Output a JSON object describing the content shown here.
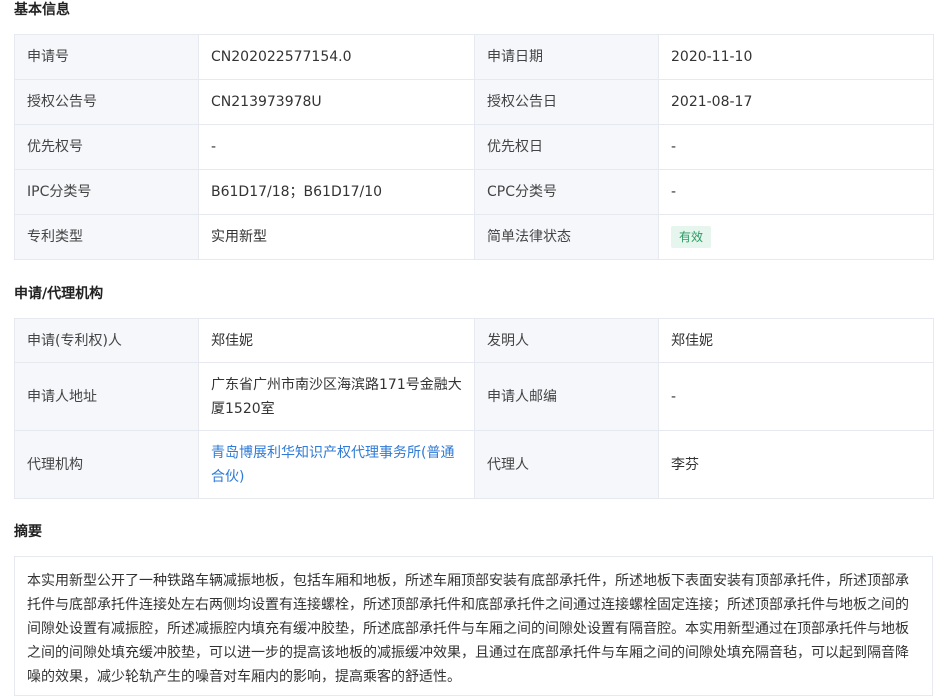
{
  "basic": {
    "title": "基本信息",
    "rows": [
      [
        "申请号",
        "CN202022577154.0",
        "申请日期",
        "2020-11-10"
      ],
      [
        "授权公告号",
        "CN213973978U",
        "授权公告日",
        "2021-08-17"
      ],
      [
        "优先权号",
        "-",
        "优先权日",
        "-"
      ],
      [
        "IPC分类号",
        "B61D17/18；B61D17/10",
        "CPC分类号",
        "-"
      ],
      [
        "专利类型",
        "实用新型",
        "简单法律状态",
        "有效"
      ]
    ]
  },
  "agency": {
    "title": "申请/代理机构",
    "rows": [
      [
        "申请(专利权)人",
        "郑佳妮",
        "发明人",
        "郑佳妮"
      ],
      [
        "申请人地址",
        "广东省广州市南沙区海滨路171号金融大厦1520室",
        "申请人邮编",
        "-"
      ],
      [
        "代理机构",
        "青岛博展利华知识产权代理事务所(普通合伙)",
        "代理人",
        "李芬"
      ]
    ]
  },
  "abstract": {
    "title": "摘要",
    "text": "本实用新型公开了一种铁路车辆减振地板，包括车厢和地板，所述车厢顶部安装有底部承托件，所述地板下表面安装有顶部承托件，所述顶部承托件与底部承托件连接处左右两侧均设置有连接螺栓，所述顶部承托件和底部承托件之间通过连接螺栓固定连接；所述顶部承托件与地板之间的间隙处设置有减振腔，所述减振腔内填充有缓冲胶垫，所述底部承托件与车厢之间的间隙处设置有隔音腔。本实用新型通过在顶部承托件与地板之间的间隙处填充缓冲胶垫，可以进一步的提高该地板的减振缓冲效果，且通过在底部承托件与车厢之间的间隙处填充隔音毡，可以起到隔音降噪的效果，减少轮轨产生的噪音对车厢内的影响，提高乘客的舒适性。"
  }
}
